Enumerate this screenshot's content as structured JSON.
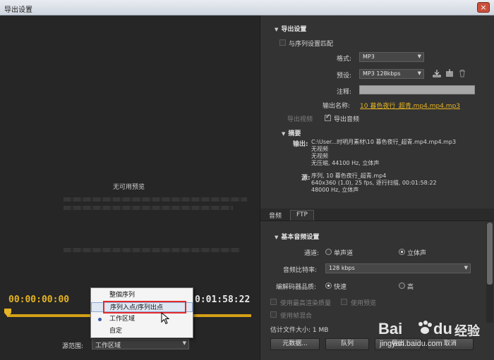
{
  "window": {
    "title": "导出设置",
    "close_glyph": "×"
  },
  "preview": {
    "no_preview_text": "无可用预览",
    "timecode_in": "00:00:00:00",
    "timecode_out": "0:01:58:22",
    "source_range_label": "源范围:",
    "source_range_value": "工作区域",
    "dropdown_options": [
      "整個序列",
      "序列入点/序列出点",
      "工作区域",
      "自定"
    ],
    "selected_option_index": 2,
    "highlighted_option_index": 1
  },
  "export_settings": {
    "header": "导出设置",
    "match_sequence_label": "与序列设置匹配",
    "format_label": "格式:",
    "format_value": "MP3",
    "preset_label": "预设:",
    "preset_value": "MP3 128kbps",
    "comments_label": "注释:",
    "output_name_label": "输出名称:",
    "output_name_value": "10 暮色夜行_超青.mp4.mp4.mp3",
    "export_video_label": "导出视频",
    "export_audio_label": "导出音频"
  },
  "summary": {
    "header": "摘要",
    "output_label": "输出:",
    "output_lines": "C:\\User...时明月素材\\10 暮色夜行_超青.mp4.mp4.mp3\n无视频\n无视频\n无压缩, 44100 Hz, 立体声",
    "source_label": "源:",
    "source_lines": "序列, 10 暮色夜行_超青.mp4\n640x360 (1.0), 25 fps, 逐行扫描, 00:01:58:22\n48000 Hz, 立体声"
  },
  "tabs": [
    "音频",
    "FTP"
  ],
  "basic_audio": {
    "header": "基本音频设置",
    "channel_label": "通道:",
    "mono_label": "单声道",
    "stereo_label": "立体声",
    "bitrate_label": "音频比特率:",
    "bitrate_value": "128 kbps",
    "codec_quality_label": "编解码器品质:",
    "fast_label": "快速",
    "high_label": "高"
  },
  "options": {
    "max_render_label": "使用最高渲染质量",
    "use_preview_label": "使用预览",
    "use_frame_blend_label": "使用帧混合",
    "estimated_size": "估计文件大小: 1 MB"
  },
  "buttons": {
    "metadata": "元数据...",
    "queue": "队列",
    "export": "导出",
    "cancel": "取消"
  },
  "watermark": {
    "brand_text": "Bai",
    "brand_text2": "du",
    "word": "经验",
    "url": "jingyan.baidu.com"
  },
  "colors": {
    "accent": "#e6b422",
    "highlight_border": "#e52b2b"
  }
}
